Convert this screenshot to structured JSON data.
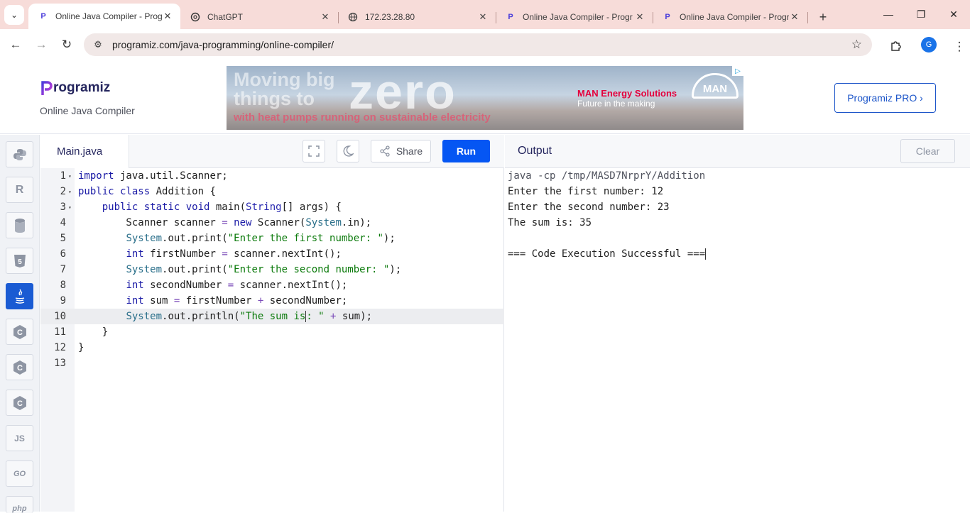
{
  "browser": {
    "tabs": [
      {
        "title": "Online Java Compiler - Progr",
        "icon": "programiz-icon",
        "active": true
      },
      {
        "title": "ChatGPT",
        "icon": "chatgpt-icon",
        "active": false
      },
      {
        "title": "172.23.28.80",
        "icon": "globe-icon",
        "active": false
      },
      {
        "title": "Online Java Compiler - Progr",
        "icon": "programiz-icon",
        "active": false
      },
      {
        "title": "Online Java Compiler - Progr",
        "icon": "programiz-icon",
        "active": false
      }
    ],
    "url": "programiz.com/java-programming/online-compiler/",
    "profile_initial": "G"
  },
  "header": {
    "logo_text": "rogramiz",
    "subtitle": "Online Java Compiler",
    "pro_button": "Programiz PRO ›",
    "ad": {
      "headline": "Moving big things to",
      "headline_big": "zero",
      "tagline": "with heat pumps running on sustainable electricity",
      "brand": "MAN Energy Solutions",
      "slogan": "Future in the making",
      "logo": "MAN"
    }
  },
  "sidebar": {
    "languages": [
      {
        "name": "python-icon",
        "label": ""
      },
      {
        "name": "r-icon",
        "label": "R"
      },
      {
        "name": "sql-icon",
        "label": ""
      },
      {
        "name": "html5-icon",
        "label": "5"
      },
      {
        "name": "java-icon",
        "label": "☕",
        "active": true
      },
      {
        "name": "c-icon",
        "label": "C"
      },
      {
        "name": "cpp-icon",
        "label": "C"
      },
      {
        "name": "csharp-icon",
        "label": "C"
      },
      {
        "name": "js-icon",
        "label": "JS"
      },
      {
        "name": "go-icon",
        "label": "GO"
      },
      {
        "name": "php-icon",
        "label": "php"
      }
    ]
  },
  "editor": {
    "file_name": "Main.java",
    "share_label": "Share",
    "run_label": "Run",
    "lines": [
      "import java.util.Scanner;",
      "public class Addition {",
      "    public static void main(String[] args) {",
      "        Scanner scanner = new Scanner(System.in);",
      "        System.out.print(\"Enter the first number: \");",
      "        int firstNumber = scanner.nextInt();",
      "        System.out.print(\"Enter the second number: \");",
      "        int secondNumber = scanner.nextInt();",
      "        int sum = firstNumber + secondNumber;",
      "        System.out.println(\"The sum is: \" + sum);",
      "    }",
      "}",
      ""
    ],
    "line_numbers": [
      "1",
      "2",
      "3",
      "4",
      "5",
      "6",
      "7",
      "8",
      "9",
      "10",
      "11",
      "12",
      "13"
    ],
    "highlighted_line": 10
  },
  "output": {
    "title": "Output",
    "clear_label": "Clear",
    "lines": [
      "java -cp /tmp/MASD7NrprY/Addition",
      "Enter the first number: 12",
      "Enter the second number: 23",
      "The sum is: 35",
      "",
      "=== Code Execution Successful ==="
    ]
  }
}
